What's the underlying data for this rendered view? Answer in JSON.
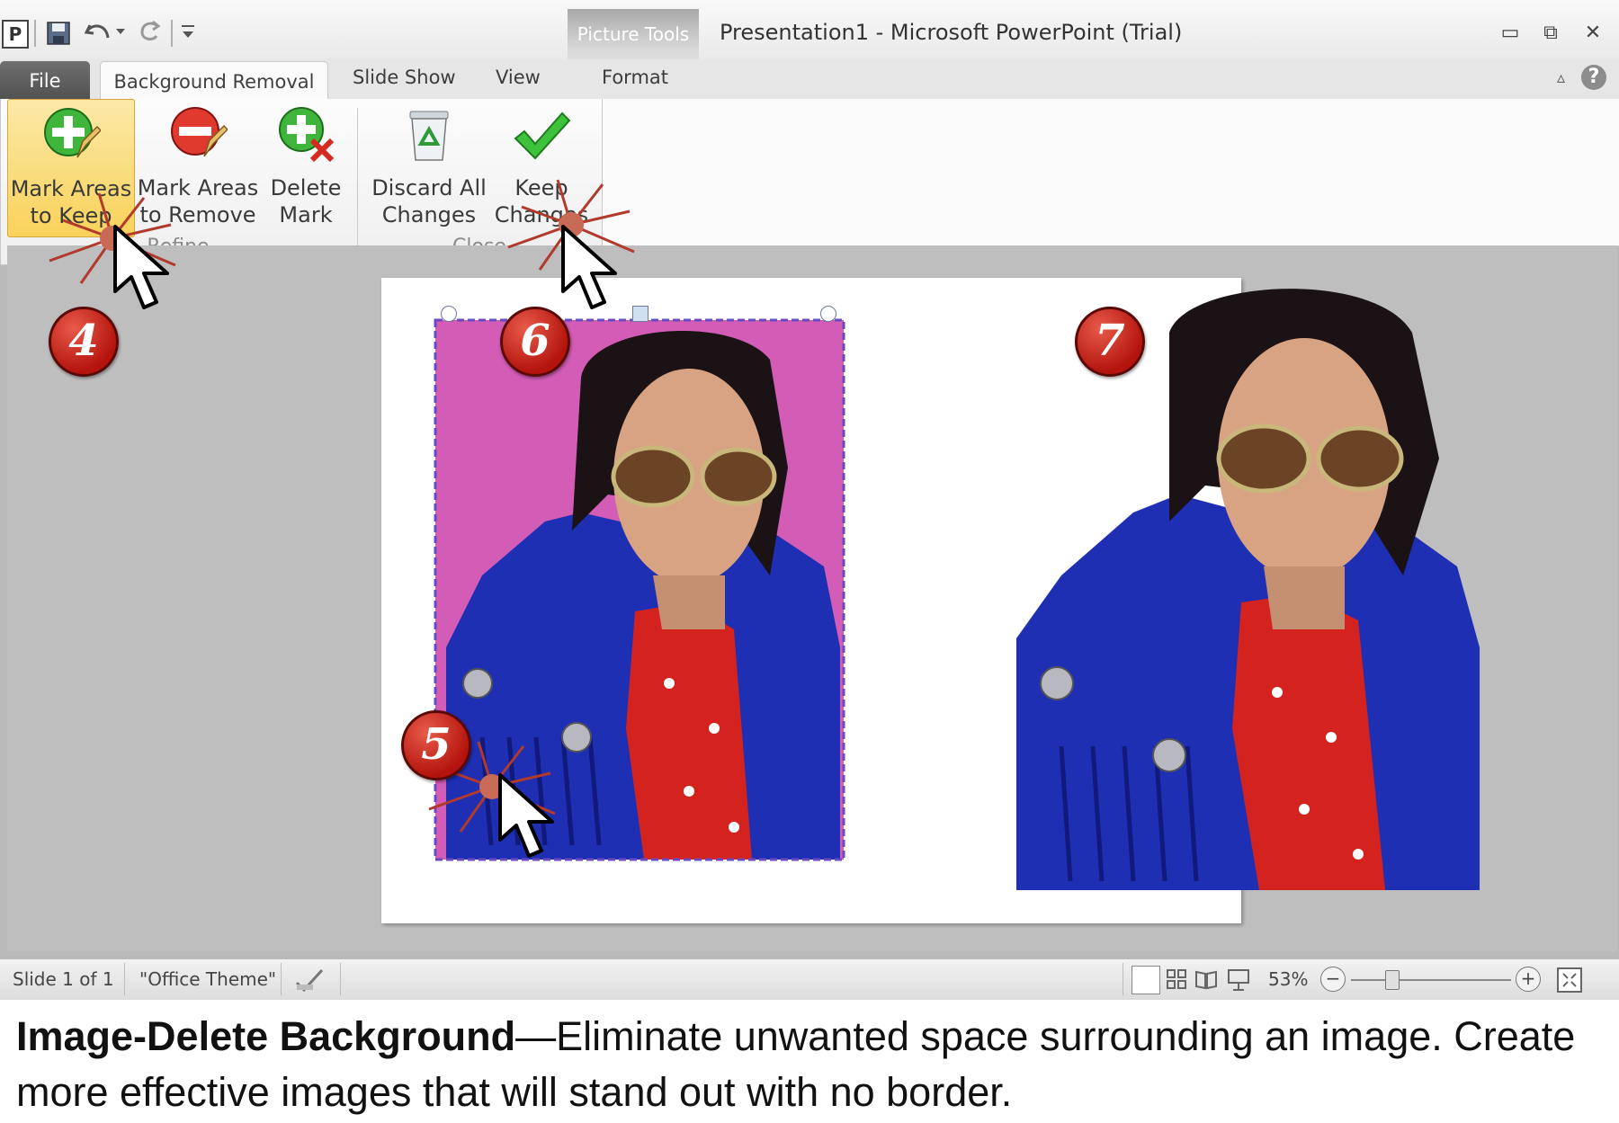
{
  "title_bar": {
    "app_icon": "P",
    "window_title": "Presentation1  -  Microsoft PowerPoint (Trial)",
    "contextual_tab_group": "Picture Tools",
    "minimize_glyph": "▭",
    "restore_glyph": "⧉",
    "close_glyph": "✕",
    "qat_icons": [
      "save-icon",
      "undo-icon",
      "redo-icon",
      "customize-qat-icon"
    ]
  },
  "tabs": {
    "file": "File",
    "background_removal": "Background Removal",
    "slide_show": "Slide Show",
    "view": "View",
    "format": "Format",
    "help_glyph": "?"
  },
  "ribbon": {
    "refine_group": {
      "label": "Refine",
      "buttons": [
        {
          "line1": "Mark Areas",
          "line2": "to Keep",
          "icon": "plus-pencil-green-icon"
        },
        {
          "line1": "Mark Areas",
          "line2": "to Remove",
          "icon": "minus-pencil-red-icon"
        },
        {
          "line1": "Delete",
          "line2": "Mark",
          "icon": "plus-x-eraser-icon"
        }
      ]
    },
    "close_group": {
      "label": "Close",
      "buttons": [
        {
          "line1": "Discard All",
          "line2": "Changes",
          "icon": "recycle-bin-icon"
        },
        {
          "line1": "Keep",
          "line2": "Changes",
          "icon": "green-check-icon"
        }
      ]
    }
  },
  "callouts": [
    "4",
    "5",
    "6",
    "7"
  ],
  "status_bar": {
    "slide_info": "Slide 1 of 1",
    "theme": "\"Office Theme\"",
    "zoom": "53%",
    "zoom_out": "−",
    "zoom_in": "+"
  },
  "caption": {
    "bold": "Image-Delete Background",
    "text": "—Eliminate unwanted space surrounding an image. Create more effective images that will stand out with no border."
  },
  "colors": {
    "removal_magenta": "#d25cb6",
    "callout_red": "#c0201a",
    "ribbon_highlight": "#f9d25a"
  }
}
